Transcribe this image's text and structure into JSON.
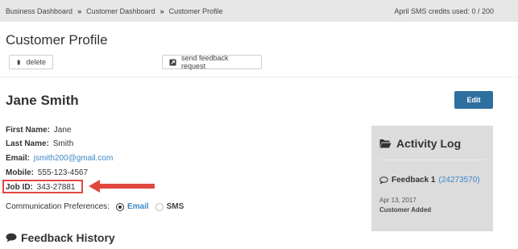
{
  "breadcrumb": {
    "items": [
      "Business Dashboard",
      "Customer Dashboard",
      "Customer Profile"
    ],
    "separator": "»"
  },
  "sms_credits": "April SMS credits used: 0 / 200",
  "page_title": "Customer Profile",
  "actions": {
    "delete_label": "delete",
    "feedback_label": "send feedback request"
  },
  "customer": {
    "name": "Jane Smith",
    "edit_label": "Edit",
    "first_name_label": "First Name:",
    "first_name": "Jane",
    "last_name_label": "Last Name:",
    "last_name": "Smith",
    "email_label": "Email:",
    "email": "jsmith200@gmail.com",
    "mobile_label": "Mobile:",
    "mobile": "555-123-4567",
    "job_id_label": "Job ID:",
    "job_id": "343-27881"
  },
  "communication": {
    "label": "Communication Preferences:",
    "options": [
      "Email",
      "SMS"
    ],
    "selected": "Email"
  },
  "feedback_history_title": "Feedback History",
  "activity_log": {
    "title": "Activity Log",
    "feedback_label": "Feedback 1",
    "feedback_id": "(24273570)",
    "date": "Apr 13, 2017",
    "status": "Customer Added"
  },
  "colors": {
    "link": "#3a87c8",
    "edit_button": "#2f6f9f",
    "highlight": "#e2473f",
    "topbar": "#e7e7e7",
    "activity_panel": "#dcdcdc"
  }
}
